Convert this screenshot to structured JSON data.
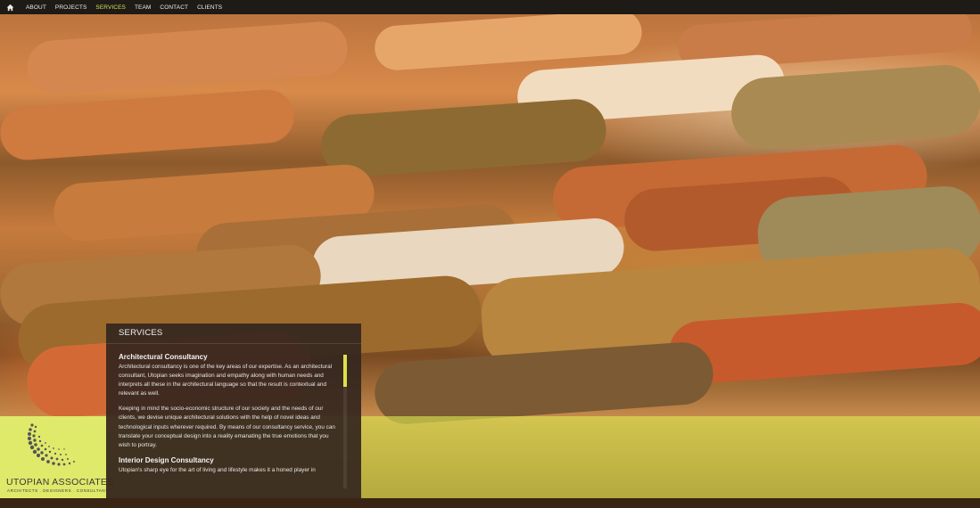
{
  "nav": {
    "home_icon": "home-icon",
    "items": [
      {
        "label": "ABOUT",
        "active": false
      },
      {
        "label": "PROJECTS",
        "active": false
      },
      {
        "label": "SERVICES",
        "active": true
      },
      {
        "label": "TEAM",
        "active": false
      },
      {
        "label": "CONTACT",
        "active": false
      },
      {
        "label": "CLIENTS",
        "active": false
      }
    ]
  },
  "panel": {
    "title": "SERVICES",
    "sections": [
      {
        "heading": "Architectural Consultancy",
        "paragraphs": [
          "Architectural consultancy is one of the key areas of our expertise. As an architectural consultant, Utopian seeks imagination and empathy along with human needs and interprets all these in the architectural language so that the result is contextual and relevant as well.",
          "Keeping in mind the socio-economic structure of our society and the needs of our clients, we devise unique architectural solutions with the help of novel ideas and technological inputs wherever required. By means of our consultancy service, you can translate your conceptual design into a reality emanating the true emotions that you wish to portray."
        ]
      },
      {
        "heading": "Interior Design Consultancy",
        "paragraphs": [
          "Utopian's sharp eye for the art of living and lifestyle makes it a honed player in"
        ]
      }
    ]
  },
  "logo": {
    "name": "UTOPIAN ASSOCIATES",
    "tagline": "ARCHITECTS . DESIGNERS . CONSULTANTS"
  },
  "colors": {
    "accent": "#d7e15a",
    "band": "#dfe96a",
    "panel_bg": "#34261e",
    "nav_bg": "#1e1a16"
  }
}
